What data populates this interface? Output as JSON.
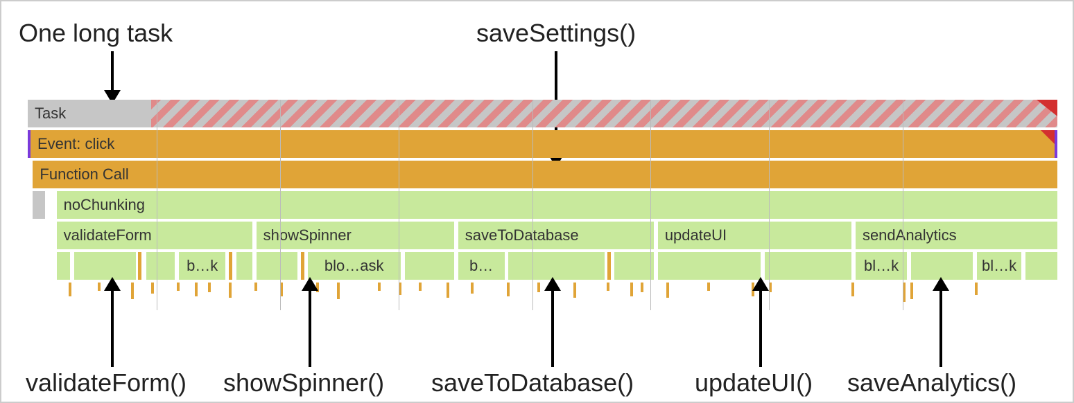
{
  "top_labels": {
    "long_task": "One long task",
    "save_settings": "saveSettings()"
  },
  "flame": {
    "task": "Task",
    "event": "Event: click",
    "function_call": "Function Call",
    "no_chunking": "noChunking",
    "children": {
      "validateForm": "validateForm",
      "showSpinner": "showSpinner",
      "saveToDatabase": "saveToDatabase",
      "updateUI": "updateUI",
      "sendAnalytics": "sendAnalytics"
    },
    "blocks": {
      "b1": "b…k",
      "b2": "blo…ask",
      "b3": "b…",
      "b4": "bl…k",
      "b5": "bl…k"
    }
  },
  "bottom_labels": {
    "validateForm": "validateForm()",
    "showSpinner": "showSpinner()",
    "saveToDatabase": "saveToDatabase()",
    "updateUI": "updateUI()",
    "saveAnalytics": "saveAnalytics()"
  }
}
